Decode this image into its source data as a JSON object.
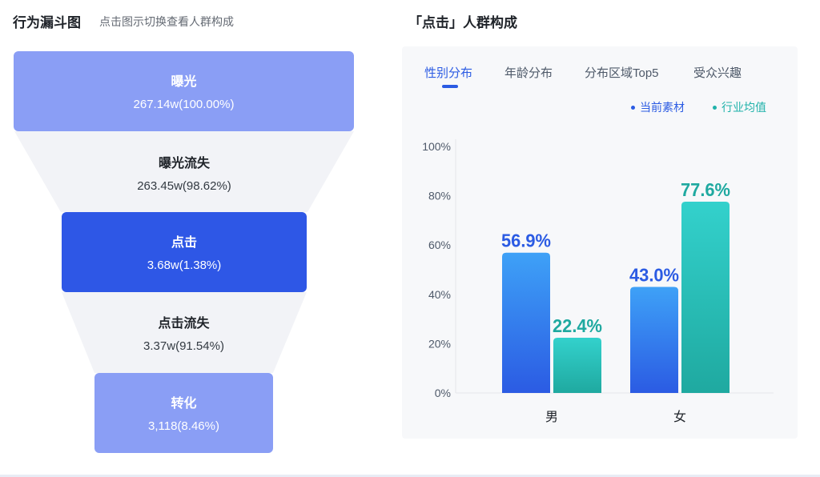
{
  "left": {
    "title": "行为漏斗图",
    "subtitle": "点击图示切换查看人群构成"
  },
  "funnel": {
    "stages": [
      {
        "name": "曝光",
        "value": "267.14w(100.00%)",
        "color": "#8a9ef5"
      },
      {
        "name": "点击",
        "value": "3.68w(1.38%)",
        "color": "#2e57e6"
      },
      {
        "name": "转化",
        "value": "3,118(8.46%)",
        "color": "#8a9ef5"
      }
    ],
    "losses": [
      {
        "name": "曝光流失",
        "value": "263.45w(98.62%)"
      },
      {
        "name": "点击流失",
        "value": "3.37w(91.54%)"
      }
    ]
  },
  "right": {
    "title": "「点击」人群构成",
    "tabs": [
      {
        "label": "性别分布",
        "active": true
      },
      {
        "label": "年龄分布",
        "active": false
      },
      {
        "label": "分布区域Top5",
        "active": false
      },
      {
        "label": "受众兴趣",
        "active": false
      }
    ]
  },
  "chart_data": {
    "type": "bar",
    "categories": [
      "男",
      "女"
    ],
    "series": [
      {
        "name": "当前素材",
        "values": [
          56.9,
          43.0
        ],
        "labels": [
          "56.9%",
          "43.0%"
        ],
        "color": "#2b5be3"
      },
      {
        "name": "行业均值",
        "values": [
          22.4,
          77.6
        ],
        "labels": [
          "22.4%",
          "77.6%"
        ],
        "color": "#20b2aa"
      }
    ],
    "yticks": [
      "0%",
      "20%",
      "40%",
      "60%",
      "80%",
      "100%"
    ],
    "ylim": [
      0,
      100
    ],
    "legend": "top-right",
    "grid": false
  }
}
